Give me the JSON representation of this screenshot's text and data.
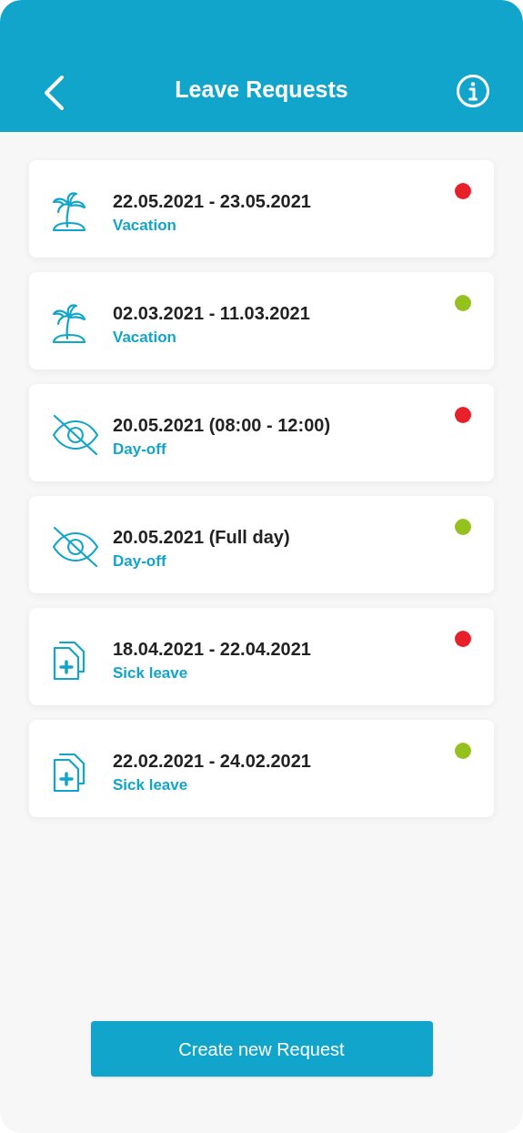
{
  "header": {
    "title": "Leave Requests"
  },
  "requests": [
    {
      "dates": "22.05.2021 - 23.05.2021",
      "type": "Vacation",
      "kind": "vacation",
      "color": "#e8202a"
    },
    {
      "dates": "02.03.2021 - 11.03.2021",
      "type": "Vacation",
      "kind": "vacation",
      "color": "#95c11f"
    },
    {
      "dates": "20.05.2021 (08:00 - 12:00)",
      "type": "Day-off",
      "kind": "day-off",
      "color": "#e8202a"
    },
    {
      "dates": "20.05.2021 (Full day)",
      "type": "Day-off",
      "kind": "day-off",
      "color": "#95c11f"
    },
    {
      "dates": "18.04.2021 - 22.04.2021",
      "type": "Sick leave",
      "kind": "sick",
      "color": "#e8202a"
    },
    {
      "dates": "22.02.2021 - 24.02.2021",
      "type": "Sick leave",
      "kind": "sick",
      "color": "#95c11f"
    }
  ],
  "create_button": "Create new Request"
}
